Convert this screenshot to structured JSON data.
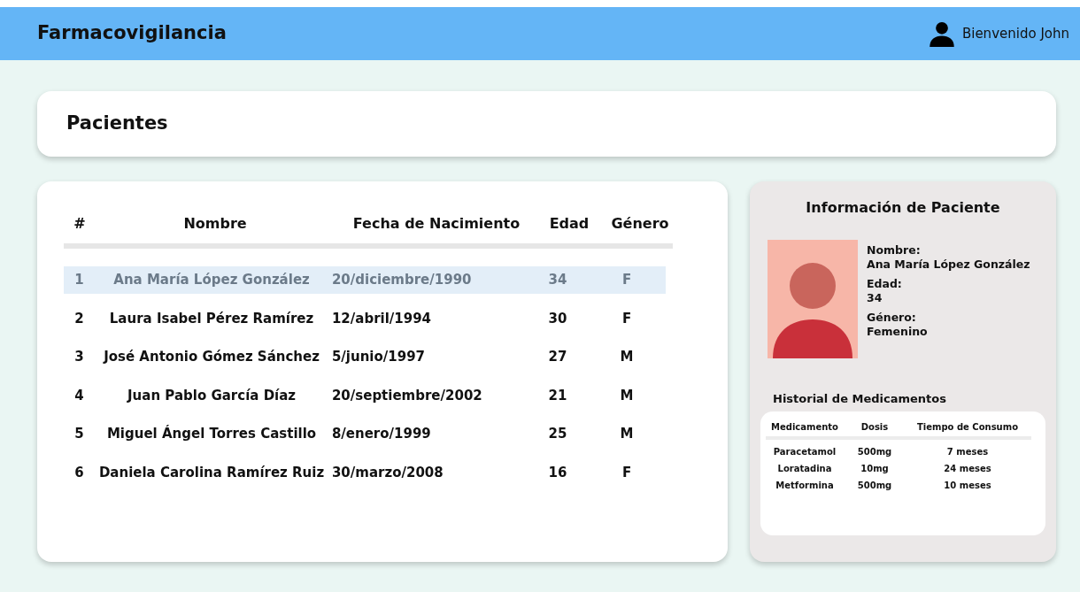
{
  "header": {
    "title": "Farmacovigilancia",
    "greeting": "Bienvenido John"
  },
  "page_title": "Pacientes",
  "table": {
    "columns": [
      "#",
      "Nombre",
      "Fecha de Nacimiento",
      "Edad",
      "Género"
    ],
    "rows": [
      {
        "cells": [
          "1",
          "Ana María López González",
          "20/diciembre/1990",
          "34",
          "F"
        ],
        "selected": true
      },
      {
        "cells": [
          "2",
          "Laura Isabel Pérez Ramírez",
          "12/abril/1994",
          "30",
          "F"
        ],
        "selected": false
      },
      {
        "cells": [
          "3",
          "José Antonio Gómez Sánchez",
          "5/junio/1997",
          "27",
          "M"
        ],
        "selected": false
      },
      {
        "cells": [
          "4",
          "Juan Pablo García Díaz",
          "20/septiembre/2002",
          "21",
          "M"
        ],
        "selected": false
      },
      {
        "cells": [
          "5",
          "Miguel Ángel Torres Castillo",
          "8/enero/1999",
          "25",
          "M"
        ],
        "selected": false
      },
      {
        "cells": [
          "6",
          "Daniela Carolina Ramírez Ruiz",
          "30/marzo/2008",
          "16",
          "F"
        ],
        "selected": false
      }
    ]
  },
  "patient_info": {
    "title": "Información de Paciente",
    "fields": [
      {
        "label": "Nombre:",
        "value": "Ana María López González"
      },
      {
        "label": "Edad:",
        "value": "34"
      },
      {
        "label": "Género:",
        "value": "Femenino"
      }
    ],
    "history_title": "Historial de Medicamentos",
    "history": {
      "columns": [
        "Medicamento",
        "Dosis",
        "Tiempo de Consumo"
      ],
      "rows": [
        [
          "Paracetamol",
          "500mg",
          "7 meses"
        ],
        [
          "Loratadina",
          "10mg",
          "24 meses"
        ],
        [
          "Metformina",
          "500mg",
          "10 meses"
        ]
      ]
    }
  }
}
